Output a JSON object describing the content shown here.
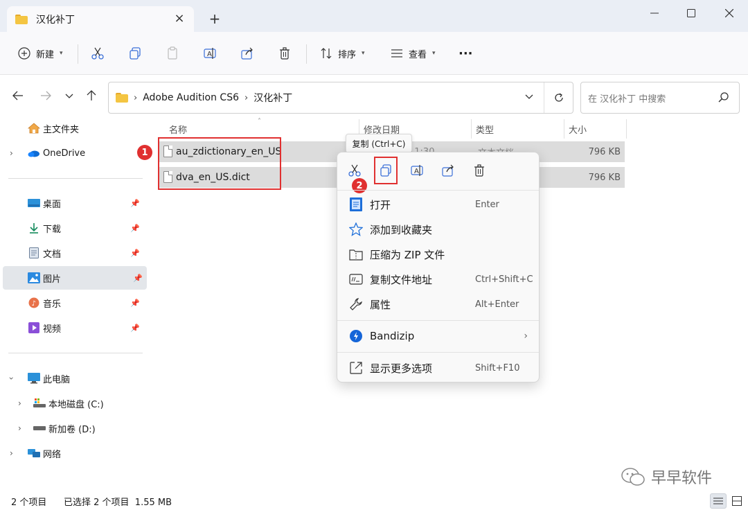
{
  "window": {
    "tab_title": "汉化补丁",
    "tab_close": "×",
    "new_tab": "+"
  },
  "toolbar": {
    "new_label": "新建",
    "sort_label": "排序",
    "view_label": "查看",
    "more": "···"
  },
  "address": {
    "path": [
      "Adobe Audition CS6",
      "汉化补丁"
    ],
    "search_placeholder": "在 汉化补丁 中搜索"
  },
  "sidebar": {
    "home": "主文件夹",
    "onedrive": "OneDrive",
    "pinned": [
      "桌面",
      "下载",
      "文档",
      "图片",
      "音乐",
      "视频"
    ],
    "this_pc": "此电脑",
    "drive_c": "本地磁盘 (C:)",
    "drive_d": "新加卷 (D:)",
    "network": "网络"
  },
  "columns": {
    "name": "名称",
    "modified": "修改日期",
    "type": "类型",
    "size": "大小"
  },
  "files": [
    {
      "name": "au_zdictionary_en_US",
      "modified": "11:30",
      "type": "文本文档",
      "size": "796 KB"
    },
    {
      "name": "dva_en_US.dict",
      "size": "796 KB"
    }
  ],
  "badges": [
    "1",
    "2"
  ],
  "tooltip": "复制 (Ctrl+C)",
  "context_menu": {
    "items": [
      {
        "label": "打开",
        "key": "Enter"
      },
      {
        "label": "添加到收藏夹",
        "key": ""
      },
      {
        "label": "压缩为 ZIP 文件",
        "key": ""
      },
      {
        "label": "复制文件地址",
        "key": "Ctrl+Shift+C"
      },
      {
        "label": "属性",
        "key": "Alt+Enter"
      }
    ],
    "bandizip": "Bandizip",
    "more_options": {
      "label": "显示更多选项",
      "key": "Shift+F10"
    }
  },
  "status": {
    "count": "2 个项目",
    "selection": "已选择 2 个项目  1.55 MB"
  },
  "watermark": "早早软件",
  "colors": {
    "highlight_red": "#e03030",
    "accent_blue": "#1a73e8"
  }
}
